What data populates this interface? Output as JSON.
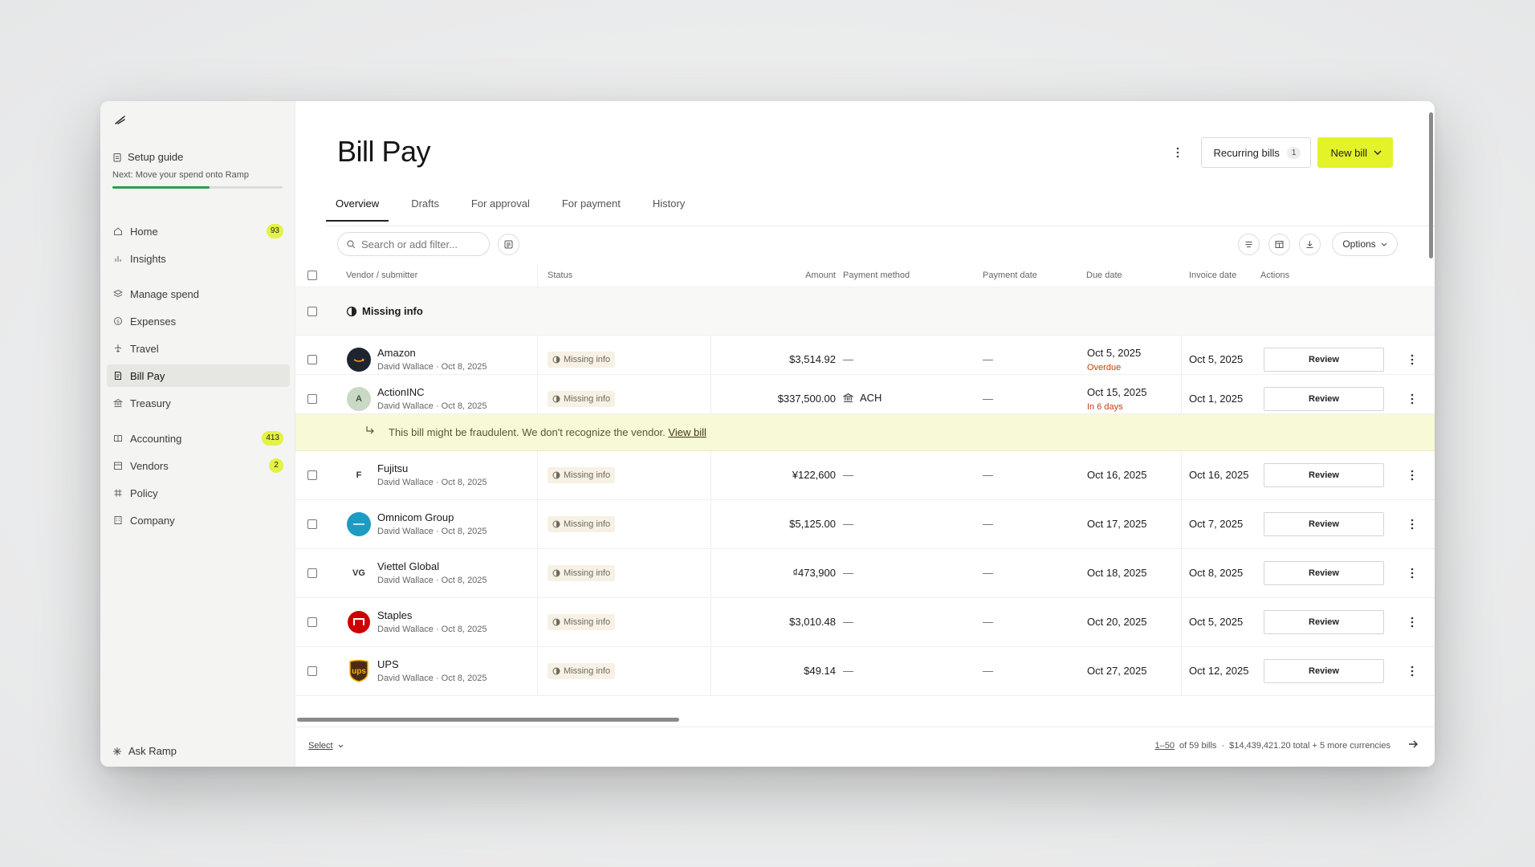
{
  "sidebar": {
    "setup": {
      "title": "Setup guide",
      "next": "Next: Move your spend onto Ramp",
      "progress": 0.57
    },
    "items": [
      {
        "label": "Home",
        "icon": "home-icon",
        "badge": "93"
      },
      {
        "label": "Insights",
        "icon": "chart-icon",
        "badge": ""
      },
      {
        "label": "Manage spend",
        "icon": "layers-icon",
        "badge": ""
      },
      {
        "label": "Expenses",
        "icon": "dollar-circle-icon",
        "badge": ""
      },
      {
        "label": "Travel",
        "icon": "plane-icon",
        "badge": ""
      },
      {
        "label": "Bill Pay",
        "icon": "bill-icon",
        "badge": "",
        "active": true
      },
      {
        "label": "Treasury",
        "icon": "bank-icon",
        "badge": ""
      },
      {
        "label": "Accounting",
        "icon": "book-icon",
        "badge": "413"
      },
      {
        "label": "Vendors",
        "icon": "store-icon",
        "badge": "2"
      },
      {
        "label": "Policy",
        "icon": "policy-icon",
        "badge": ""
      },
      {
        "label": "Company",
        "icon": "building-icon",
        "badge": ""
      }
    ],
    "ask": "Ask Ramp"
  },
  "header": {
    "title": "Bill Pay",
    "recurring_label": "Recurring bills",
    "recurring_count": "1",
    "new_bill_label": "New bill"
  },
  "tabs": [
    "Overview",
    "Drafts",
    "For approval",
    "For payment",
    "History"
  ],
  "toolbar": {
    "search_placeholder": "Search or add filter...",
    "options_label": "Options"
  },
  "table": {
    "columns": {
      "vendor": "Vendor / submitter",
      "status": "Status",
      "amount": "Amount",
      "payment_method": "Payment method",
      "payment_date": "Payment date",
      "due_date": "Due date",
      "invoice_date": "Invoice date",
      "actions": "Actions"
    },
    "group_label": "Missing info",
    "warning": {
      "text": "This bill might be fraudulent. We don't recognize the vendor.",
      "link": "View bill"
    },
    "rows": [
      {
        "vendor": "Amazon",
        "sub": "David Wallace · Oct 8, 2025",
        "status": "Missing info",
        "amount": "$3,514.92",
        "method": "—",
        "payment_date": "—",
        "due": "Oct 5, 2025",
        "due_note": "Overdue",
        "invoice": "Oct 5, 2025",
        "action": "Review",
        "avatar": ""
      },
      {
        "vendor": "ActionINC",
        "sub": "David Wallace · Oct 8, 2025",
        "status": "Missing info",
        "amount": "$337,500.00",
        "method": "ACH",
        "payment_date": "—",
        "due": "Oct 15, 2025",
        "due_note": "In 6 days",
        "invoice": "Oct 1, 2025",
        "action": "Review",
        "avatar": "A"
      },
      {
        "vendor": "Fujitsu",
        "sub": "David Wallace · Oct 8, 2025",
        "status": "Missing info",
        "amount": "¥122,600",
        "method": "—",
        "payment_date": "—",
        "due": "Oct 16, 2025",
        "due_note": "",
        "invoice": "Oct 16, 2025",
        "action": "Review",
        "avatar": "F"
      },
      {
        "vendor": "Omnicom Group",
        "sub": "David Wallace · Oct 8, 2025",
        "status": "Missing info",
        "amount": "$5,125.00",
        "method": "—",
        "payment_date": "—",
        "due": "Oct 17, 2025",
        "due_note": "",
        "invoice": "Oct 7, 2025",
        "action": "Review",
        "avatar": ""
      },
      {
        "vendor": "Viettel Global",
        "sub": "David Wallace · Oct 8, 2025",
        "status": "Missing info",
        "amount": "₫473,900",
        "method": "—",
        "payment_date": "—",
        "due": "Oct 18, 2025",
        "due_note": "",
        "invoice": "Oct 8, 2025",
        "action": "Review",
        "avatar": "VG"
      },
      {
        "vendor": "Staples",
        "sub": "David Wallace · Oct 8, 2025",
        "status": "Missing info",
        "amount": "$3,010.48",
        "method": "—",
        "payment_date": "—",
        "due": "Oct 20, 2025",
        "due_note": "",
        "invoice": "Oct 5, 2025",
        "action": "Review",
        "avatar": ""
      },
      {
        "vendor": "UPS",
        "sub": "David Wallace · Oct 8, 2025",
        "status": "Missing info",
        "amount": "$49.14",
        "method": "—",
        "payment_date": "—",
        "due": "Oct 27, 2025",
        "due_note": "",
        "invoice": "Oct 12, 2025",
        "action": "Review",
        "avatar": "ups"
      }
    ]
  },
  "footer": {
    "select": "Select",
    "range": "1–50",
    "of": "of 59 bills",
    "sep": "·",
    "total": "$14,439,421.20 total + 5 more currencies"
  },
  "colors": {
    "accent": "#e4f22a",
    "badge": "#e4f246",
    "overdue": "#c2410c",
    "warning_bg": "#f8f9d7",
    "progress": "#2f9d4b"
  }
}
